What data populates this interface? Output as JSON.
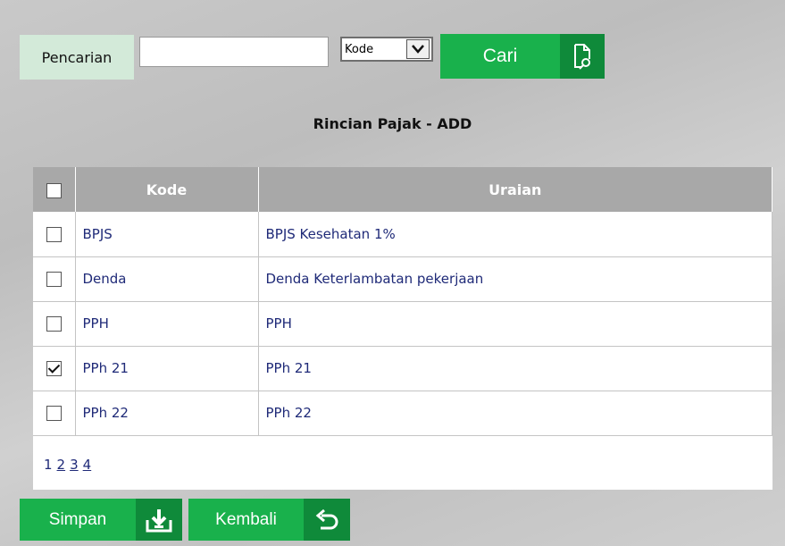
{
  "search": {
    "label": "Pencarian",
    "input_value": "",
    "select_value": "Kode",
    "button_label": "Cari"
  },
  "page_title": "Rincian Pajak - ADD",
  "table": {
    "headers": [
      "Kode",
      "Uraian"
    ],
    "rows": [
      {
        "kode": "BPJS",
        "uraian": "BPJS Kesehatan 1%",
        "checked": false
      },
      {
        "kode": "Denda",
        "uraian": "Denda Keterlambatan pekerjaan",
        "checked": false
      },
      {
        "kode": "PPH",
        "uraian": "PPH",
        "checked": false
      },
      {
        "kode": "PPh 21",
        "uraian": "PPh 21",
        "checked": true
      },
      {
        "kode": "PPh 22",
        "uraian": "PPh 22",
        "checked": false
      }
    ]
  },
  "pagination": {
    "current": "1",
    "pages": [
      "2",
      "3",
      "4"
    ]
  },
  "actions": {
    "save_label": "Simpan",
    "back_label": "Kembali"
  },
  "colors": {
    "accent": "#19b14c",
    "accent_dark": "#0f8a3a",
    "label_bg": "#d3ead9",
    "header_bg": "#a8a8a8",
    "link": "#1f2a78"
  }
}
